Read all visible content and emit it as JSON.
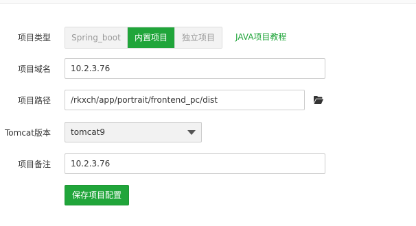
{
  "form": {
    "type": {
      "label": "项目类型",
      "options": [
        "Spring_boot",
        "内置项目",
        "独立项目"
      ],
      "selected": "内置项目",
      "help_link": "JAVA项目教程"
    },
    "domain": {
      "label": "项目域名",
      "value": "10.2.3.76"
    },
    "path": {
      "label": "项目路径",
      "value": "/rkxch/app/portrait/frontend_pc/dist",
      "icon": "folder-open-icon"
    },
    "tomcat": {
      "label": "Tomcat版本",
      "value": "tomcat9"
    },
    "note": {
      "label": "项目备注",
      "value": "10.2.3.76"
    },
    "save_label": "保存项目配置"
  },
  "colors": {
    "accent": "#20a53a",
    "inactive_bg": "#f3f3f3",
    "inactive_text": "#999999"
  }
}
